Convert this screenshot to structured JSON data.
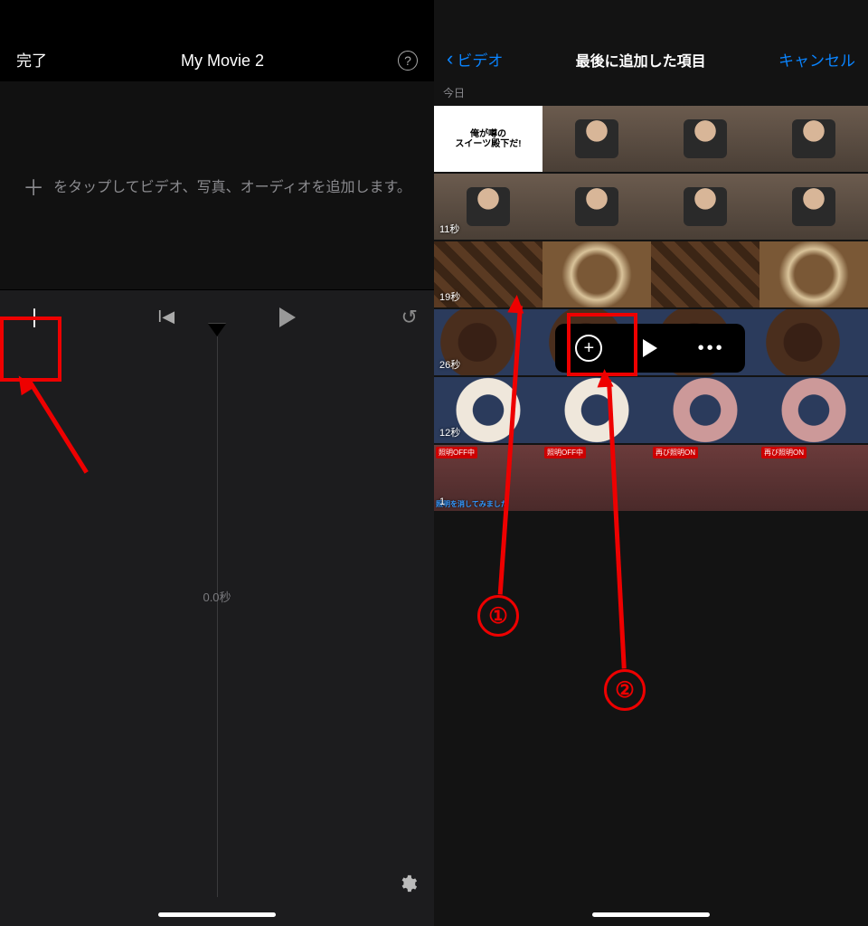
{
  "left": {
    "done": "完了",
    "title": "My Movie 2",
    "help": "?",
    "hint_text": "をタップしてビデオ、写真、オーディオを追加します。",
    "time_label": "0.0秒"
  },
  "right": {
    "back_label": "ビデオ",
    "title": "最後に追加した項目",
    "cancel": "キャンセル",
    "section_label": "今日",
    "rows": [
      {
        "duration": "",
        "type": "first"
      },
      {
        "duration": "11秒",
        "type": "person"
      },
      {
        "duration": "19秒",
        "type": "choco",
        "selected": true
      },
      {
        "duration": "26秒",
        "type": "donut"
      },
      {
        "duration": "12秒",
        "type": "white"
      },
      {
        "duration": "1",
        "type": "overlay"
      }
    ],
    "overlay_top_text": "照明OFF中",
    "overlay_top_text_alt": "再び照明ON",
    "overlay_bottom_text": "照明を消してみました",
    "first_cell_line1": "俺が噂の",
    "first_cell_line2": "スイーツ殿下だ!"
  },
  "popover": {
    "plus": "+",
    "more": "•••"
  },
  "annotations": {
    "step1": "①",
    "step2": "②"
  }
}
